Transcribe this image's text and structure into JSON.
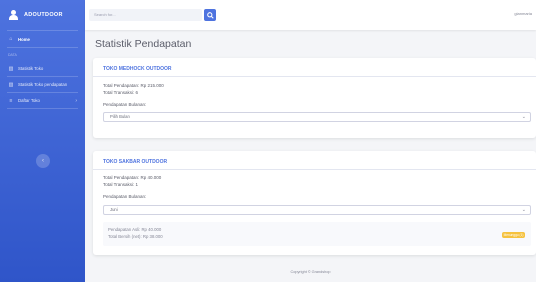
{
  "sidebar": {
    "brand": "ADOUTDOOR",
    "home": "Home",
    "section": "Data",
    "items": [
      {
        "label": "Statistik Toko",
        "icon": "chart-icon"
      },
      {
        "label": "Statistik Toko pendapatan",
        "icon": "chart-icon"
      },
      {
        "label": "Daftar Toko",
        "icon": "list-icon"
      }
    ],
    "toggle_icon": "chevron-left-icon"
  },
  "topbar": {
    "search_placeholder": "Search for...",
    "user_name": "gianmaria"
  },
  "page": {
    "title": "Statistik Pendapatan"
  },
  "cards": [
    {
      "store": "TOKO MEDHOCK OUTDOOR",
      "total_income": "Total Pendapatan: Rp 215.000",
      "total_transactions": "Total Transaksi: 6",
      "monthly_label": "Pendapatan Bulanan:",
      "month_select": "Pilih Bulan"
    },
    {
      "store": "TOKO SAKBAR OUTDOOR",
      "total_income": "Total Pendapatan: Rp 40.000",
      "total_transactions": "Total Transaksi: 1",
      "monthly_label": "Pendapatan Bulanan:",
      "month_select": "Juni",
      "summary_line1": "Pendapatan Asli: Rp 40.000",
      "summary_line2": "Total Bersih (net): Rp 38.000",
      "badge": "Menunggu (1)"
    }
  ],
  "footer": "Copyright © Grandshop",
  "colors": {
    "sidebar": "#4e73df",
    "accent": "#4e73df",
    "badge": "#f6c23e"
  }
}
